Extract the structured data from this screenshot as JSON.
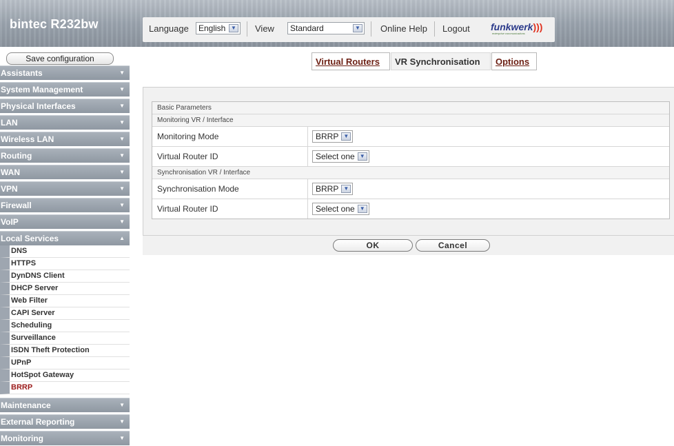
{
  "header": {
    "brand": "bintec R232bw",
    "language_label": "Language",
    "language_value": "English",
    "view_label": "View",
    "view_value": "Standard",
    "online_help": "Online Help",
    "logout": "Logout",
    "logo_text": "funkwerk",
    "logo_mark": ")))",
    "logo_sub": "enterprise communications"
  },
  "sidebar": {
    "save_label": "Save configuration",
    "categories": [
      {
        "label": "Assistants",
        "arrow": "▼"
      },
      {
        "label": "System Management",
        "arrow": "▼"
      },
      {
        "label": "Physical Interfaces",
        "arrow": "▼"
      },
      {
        "label": "LAN",
        "arrow": "▼"
      },
      {
        "label": "Wireless LAN",
        "arrow": "▼"
      },
      {
        "label": "Routing",
        "arrow": "▼"
      },
      {
        "label": "WAN",
        "arrow": "▼"
      },
      {
        "label": "VPN",
        "arrow": "▼"
      },
      {
        "label": "Firewall",
        "arrow": "▼"
      },
      {
        "label": "VoIP",
        "arrow": "▼"
      },
      {
        "label": "Local Services",
        "arrow": "▲"
      }
    ],
    "local_services_items": [
      "DNS",
      "HTTPS",
      "DynDNS Client",
      "DHCP Server",
      "Web Filter",
      "CAPI Server",
      "Scheduling",
      "Surveillance",
      "ISDN Theft Protection",
      "UPnP",
      "HotSpot Gateway",
      "BRRP"
    ],
    "bottom_categories": [
      {
        "label": "Maintenance",
        "arrow": "▼"
      },
      {
        "label": "External Reporting",
        "arrow": "▼"
      },
      {
        "label": "Monitoring",
        "arrow": "▼"
      }
    ]
  },
  "tabs": {
    "virtual_routers": "Virtual Routers",
    "vr_sync": "VR Synchronisation",
    "options": "Options"
  },
  "form": {
    "basic_parameters": "Basic Parameters",
    "monitoring_section": "Monitoring VR / Interface",
    "monitoring_mode_label": "Monitoring Mode",
    "monitoring_mode_value": "BRRP",
    "virtual_router_id_label": "Virtual Router ID",
    "virtual_router_id_value": "Select one",
    "sync_section": "Synchronisation VR / Interface",
    "sync_mode_label": "Synchronisation Mode",
    "sync_mode_value": "BRRP",
    "sync_router_id_label": "Virtual Router ID",
    "sync_router_id_value": "Select one"
  },
  "buttons": {
    "ok": "OK",
    "cancel": "Cancel"
  },
  "colors": {
    "nav_bg": "#9aa3ad",
    "link": "#6b1e12",
    "active_item": "#9b1a1a"
  }
}
